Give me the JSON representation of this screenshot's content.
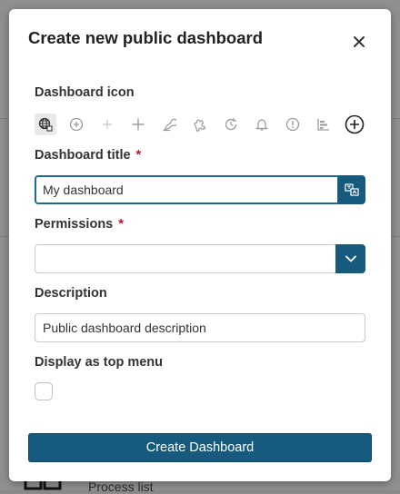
{
  "background": {
    "item_label": "Process list"
  },
  "modal": {
    "title": "Create new public dashboard",
    "close_icon": "close-icon"
  },
  "form": {
    "icon_section": {
      "label": "Dashboard icon",
      "selected_index": 0,
      "options": [
        "globe-network-icon",
        "add-circle-icon",
        "plus-thin-icon",
        "plus-icon",
        "map-pin-icon",
        "puzzle-icon",
        "clock-refresh-icon",
        "bell-icon",
        "info-circle-icon",
        "bar-chart-icon",
        "add-circle-bold-icon"
      ]
    },
    "title_field": {
      "label": "Dashboard title",
      "required_mark": "*",
      "value": "My dashboard",
      "translate_icon": "translate-icon"
    },
    "permissions_field": {
      "label": "Permissions",
      "required_mark": "*",
      "value": "",
      "dropdown_icon": "chevron-down-icon"
    },
    "description_field": {
      "label": "Description",
      "placeholder": "Public dashboard description"
    },
    "top_menu": {
      "label": "Display as top menu",
      "checked": false
    },
    "submit_label": "Create Dashboard"
  },
  "colors": {
    "primary": "#165a7e",
    "required": "#c8102e",
    "overlay": "#8a8a8a"
  }
}
